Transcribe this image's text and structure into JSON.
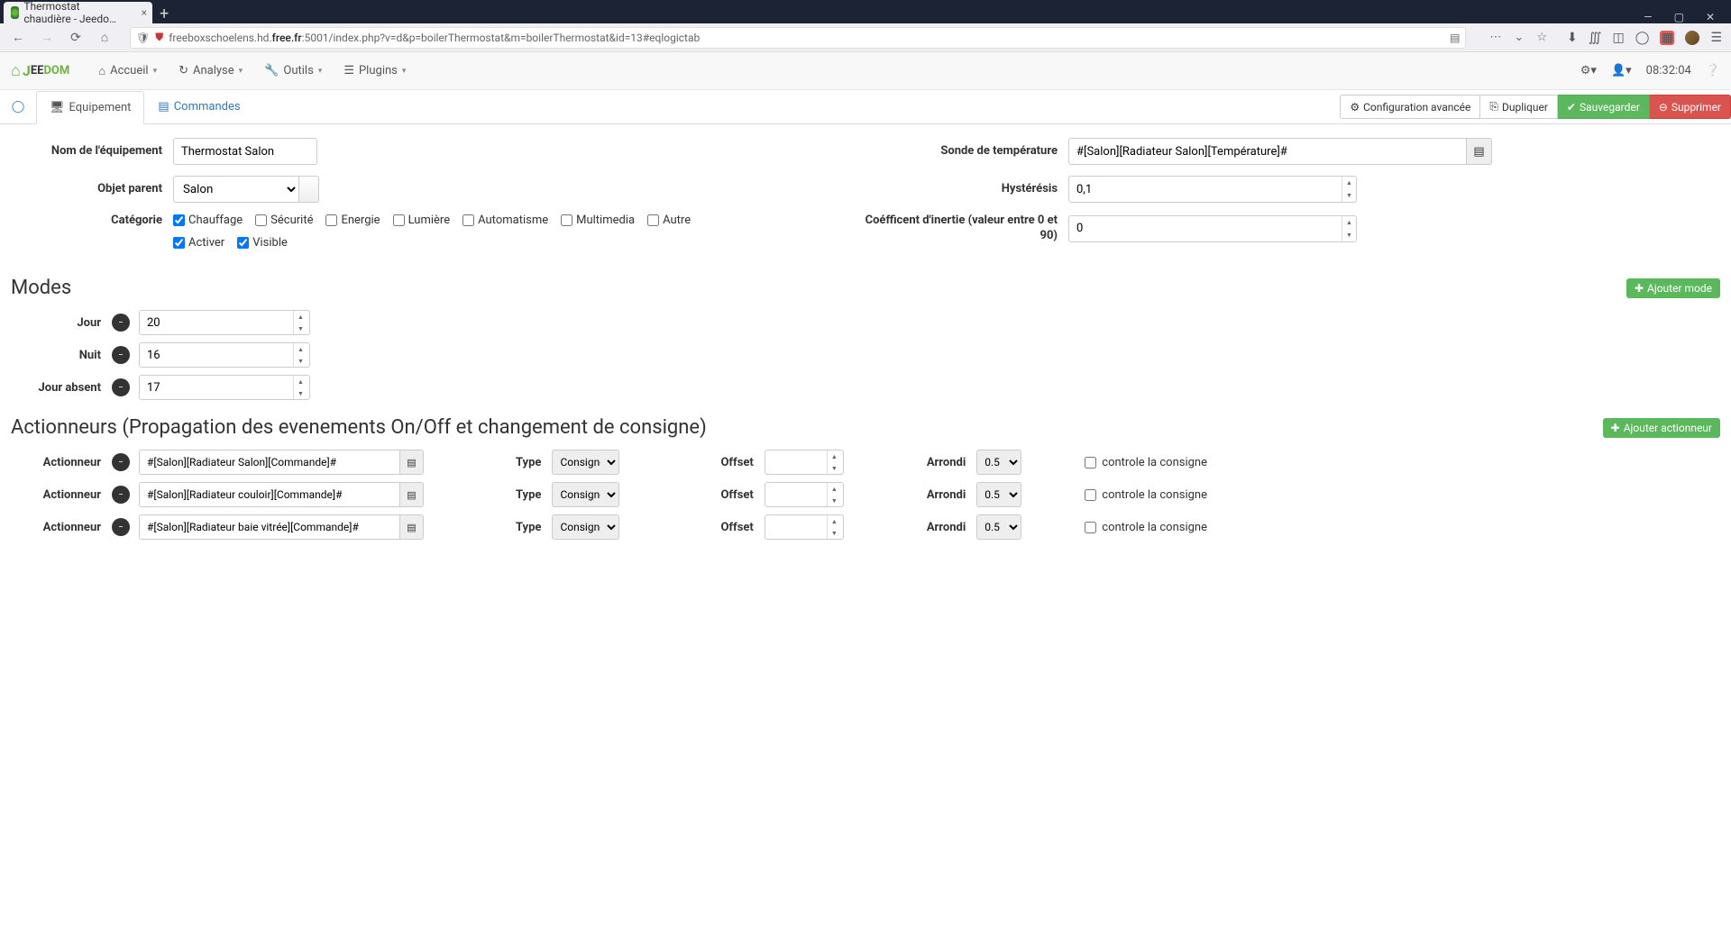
{
  "browser": {
    "tab_title": "Thermostat chaudière - Jeedo…",
    "url_prefix": "freeboxschoelens.hd.",
    "url_bold": "free.fr",
    "url_suffix": ":5001/index.php?v=d&p=boilerThermostat&m=boilerThermostat&id=13#eqlogictab"
  },
  "nav": {
    "accueil": "Accueil",
    "analyse": "Analyse",
    "outils": "Outils",
    "plugins": "Plugins",
    "clock": "08:32:04"
  },
  "tabs": {
    "equipement": "Equipement",
    "commandes": "Commandes"
  },
  "buttons": {
    "config_avancee": "Configuration avancée",
    "dupliquer": "Dupliquer",
    "sauvegarder": "Sauvegarder",
    "supprimer": "Supprimer",
    "ajouter_mode": "Ajouter mode",
    "ajouter_actionneur": "Ajouter actionneur"
  },
  "labels": {
    "nom_equipement": "Nom de l'équipement",
    "objet_parent": "Objet parent",
    "categorie": "Catégorie",
    "sonde": "Sonde de température",
    "hysteresis": "Hystérésis",
    "coefficient": "Coéfficent d'inertie (valeur entre 0 et 90)",
    "type": "Type",
    "offset": "Offset",
    "arrondi": "Arrondi",
    "controle": "controle la consigne",
    "actionneur": "Actionneur"
  },
  "values": {
    "nom_equipement": "Thermostat Salon",
    "objet_parent": "Salon",
    "sonde": "#[Salon][Radiateur Salon][Température]#",
    "hysteresis": "0,1",
    "coefficient": "0"
  },
  "categories": {
    "chauffage": "Chauffage",
    "securite": "Sécurité",
    "energie": "Energie",
    "lumiere": "Lumière",
    "automatisme": "Automatisme",
    "multimedia": "Multimedia",
    "autre": "Autre",
    "activer": "Activer",
    "visible": "Visible"
  },
  "sections": {
    "modes": "Modes",
    "actionneurs": "Actionneurs (Propagation des evenements On/Off et changement de consigne)"
  },
  "modes": [
    {
      "name": "Jour",
      "value": "20"
    },
    {
      "name": "Nuit",
      "value": "16"
    },
    {
      "name": "Jour absent",
      "value": "17"
    }
  ],
  "actionneurs": [
    {
      "cmd": "#[Salon][Radiateur Salon][Commande]#",
      "type": "Consigne",
      "offset": "",
      "arrondi": "0.5"
    },
    {
      "cmd": "#[Salon][Radiateur couloir][Commande]#",
      "type": "Consigne",
      "offset": "",
      "arrondi": "0.5"
    },
    {
      "cmd": "#[Salon][Radiateur baie vitrée][Commande]#",
      "type": "Consigne",
      "offset": "",
      "arrondi": "0.5"
    }
  ]
}
